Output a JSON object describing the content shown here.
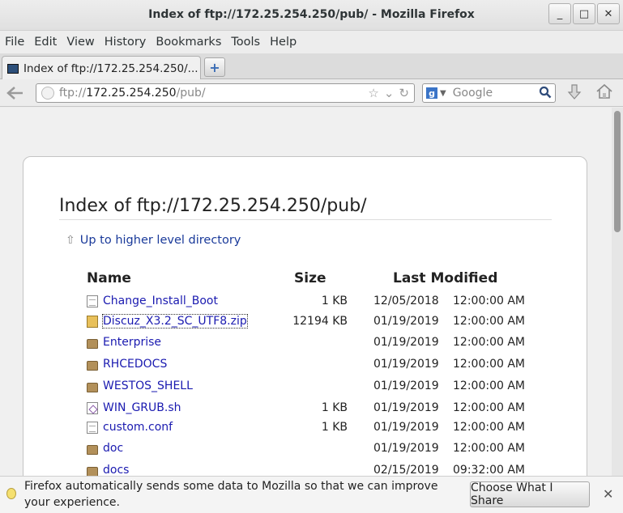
{
  "window": {
    "title": "Index of ftp://172.25.254.250/pub/ - Mozilla Firefox",
    "controls": [
      "_",
      "□",
      "✕"
    ]
  },
  "menu": [
    "File",
    "Edit",
    "View",
    "History",
    "Bookmarks",
    "Tools",
    "Help"
  ],
  "tab": {
    "label": "Index of ftp://172.25.254.250/...",
    "new_tab": "+"
  },
  "navbar": {
    "url_scheme": "ftp://",
    "url_host": "172.25.254.250",
    "url_path": "/pub/",
    "search_engine": "g",
    "search_placeholder": "Google"
  },
  "page": {
    "heading": "Index of ftp://172.25.254.250/pub/",
    "up_link": "Up to higher level directory",
    "columns": {
      "name": "Name",
      "size": "Size",
      "modified": "Last Modified"
    },
    "files": [
      {
        "name": "Change_Install_Boot",
        "size": "1 KB",
        "date": "12/05/2018",
        "time": "12:00:00 AM",
        "icon": "file"
      },
      {
        "name": "Discuz_X3.2_SC_UTF8.zip",
        "size": "12194 KB",
        "date": "01/19/2019",
        "time": "12:00:00 AM",
        "icon": "zip"
      },
      {
        "name": "Enterprise",
        "size": "",
        "date": "01/19/2019",
        "time": "12:00:00 AM",
        "icon": "folder"
      },
      {
        "name": "RHCEDOCS",
        "size": "",
        "date": "01/19/2019",
        "time": "12:00:00 AM",
        "icon": "folder"
      },
      {
        "name": "WESTOS_SHELL",
        "size": "",
        "date": "01/19/2019",
        "time": "12:00:00 AM",
        "icon": "folder"
      },
      {
        "name": "WIN_GRUB.sh",
        "size": "1 KB",
        "date": "01/19/2019",
        "time": "12:00:00 AM",
        "icon": "script"
      },
      {
        "name": "custom.conf",
        "size": "1 KB",
        "date": "01/19/2019",
        "time": "12:00:00 AM",
        "icon": "file"
      },
      {
        "name": "doc",
        "size": "",
        "date": "01/19/2019",
        "time": "12:00:00 AM",
        "icon": "folder"
      },
      {
        "name": "docs",
        "size": "",
        "date": "02/15/2019",
        "time": "09:32:00 AM",
        "icon": "folder"
      }
    ]
  },
  "notification": {
    "message": "Firefox automatically sends some data to Mozilla so that we can improve your experience.",
    "button": "Choose What I Share",
    "close": "✕"
  }
}
